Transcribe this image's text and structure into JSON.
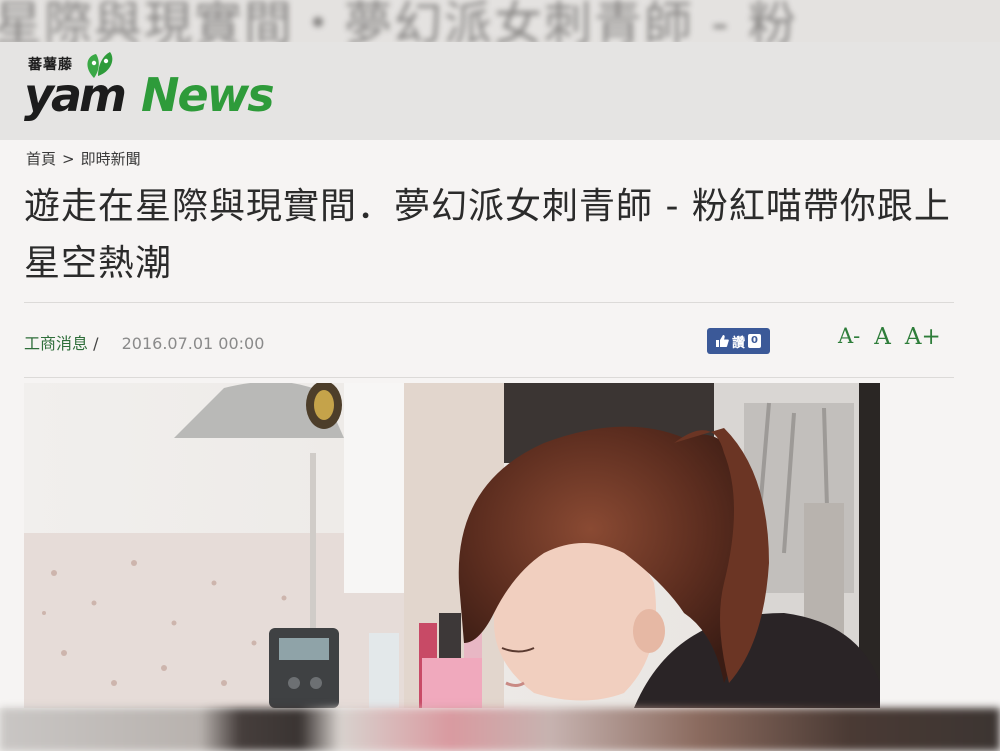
{
  "ghost_top_text": "星際與現實間・夢幻派女刺青師 - 粉",
  "header": {
    "logo_cn": "蕃薯藤",
    "logo_yam": "yam",
    "logo_news": "News"
  },
  "breadcrumb": {
    "home": "首頁",
    "separator": ">",
    "section": "即時新聞"
  },
  "article": {
    "title": "遊走在星際與現實間．夢幻派女刺青師 - 粉紅喵帶你跟上星空熱潮",
    "category": "工商消息",
    "category_sep": "/",
    "date": "2016.07.01 00:00",
    "like_label": "讚",
    "like_count": "0"
  },
  "font_controls": {
    "decrease": "A-",
    "normal": "A",
    "increase": "A+"
  },
  "colors": {
    "brand_green": "#2e9b3a",
    "facebook_blue": "#3b5998",
    "header_bg": "#e5e4e3"
  },
  "icons": {
    "like": "thumbs-up-icon"
  }
}
